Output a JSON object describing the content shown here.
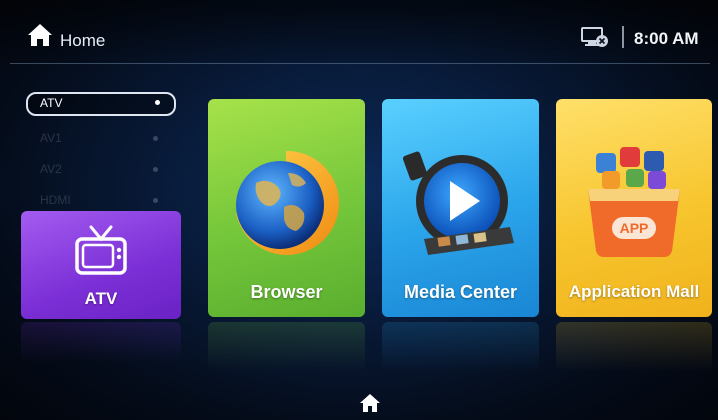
{
  "header": {
    "title": "Home",
    "time": "8:00 AM",
    "icons": {
      "home": "home-icon",
      "network": "network-disconnected-icon"
    }
  },
  "sources": [
    {
      "label": "ATV",
      "active": true
    },
    {
      "label": "AV1",
      "active": false
    },
    {
      "label": "AV2",
      "active": false
    },
    {
      "label": "HDMI",
      "active": false
    }
  ],
  "tiles": [
    {
      "label": "ATV",
      "icon": "tv-icon",
      "color": "#7b2fd6"
    },
    {
      "label": "Browser",
      "icon": "globe-icon",
      "color": "#74c63a"
    },
    {
      "label": "Media Center",
      "icon": "play-icon",
      "color": "#2aa4ea"
    },
    {
      "label": "Application Mall",
      "icon": "app-bag-icon",
      "color": "#f7c52e"
    }
  ],
  "app_bag_text": "APP",
  "footer": {
    "icon": "home-icon"
  }
}
